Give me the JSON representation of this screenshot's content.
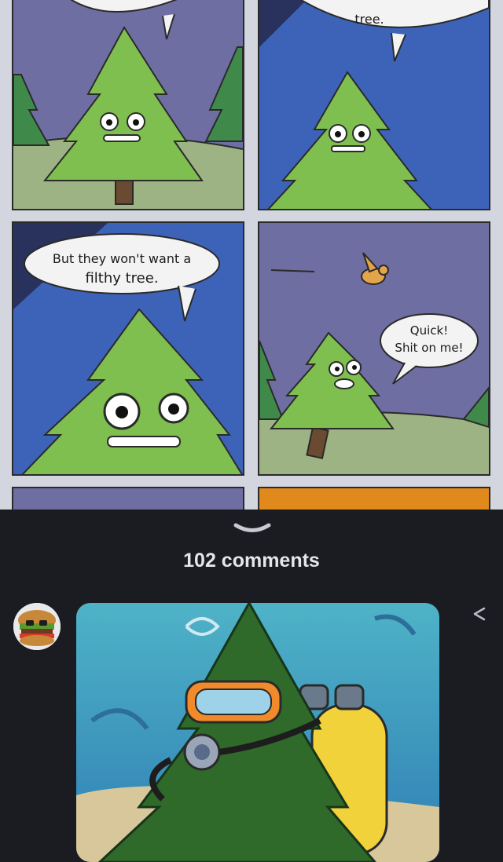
{
  "comic": {
    "panel1_caption": "tree.",
    "panel3_caption_line1": "But they won't want a",
    "panel3_caption_line2": "filthy tree.",
    "panel4_caption_line1": "Quick!",
    "panel4_caption_line2": "Shit on me!"
  },
  "comments": {
    "count_label": "102 comments"
  },
  "icons": {
    "collapse": "chevron-down-icon",
    "share": "share-icon"
  },
  "colors": {
    "background": "#1b1c21",
    "tree_green": "#7fbf4f",
    "sky_blue": "#3d63b9",
    "sky_purple": "#6f6ea3",
    "orange_panel": "#e08a1d"
  }
}
